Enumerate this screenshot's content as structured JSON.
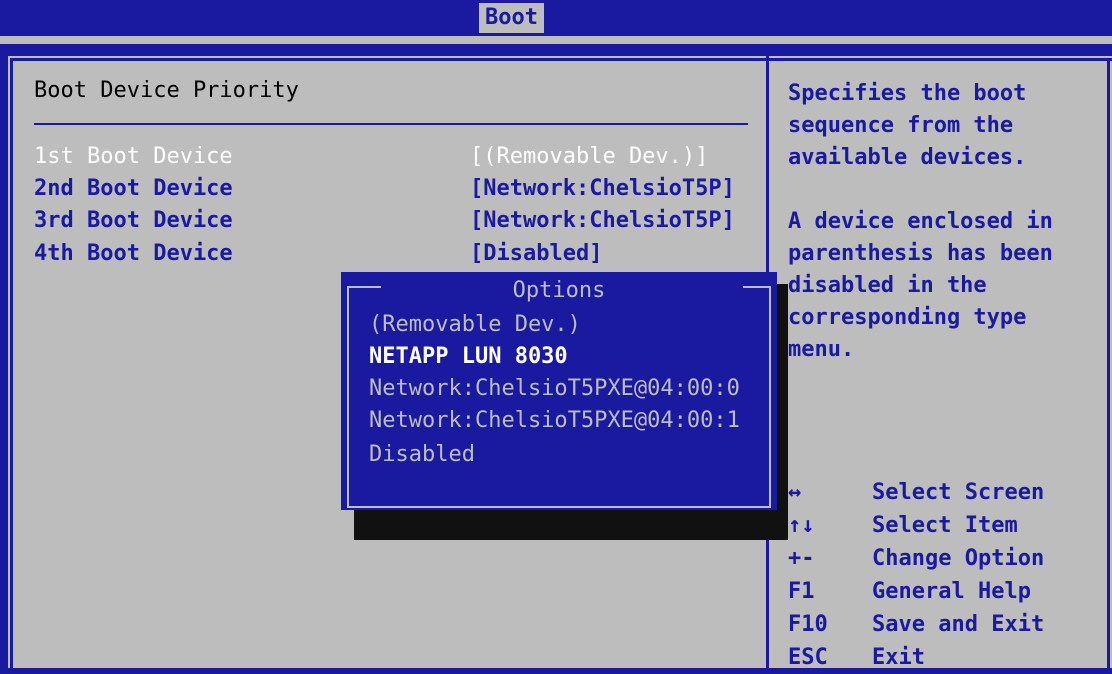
{
  "header": {
    "title": "Boot"
  },
  "main": {
    "section_title": "Boot Device Priority",
    "rows": [
      {
        "label": "1st Boot Device",
        "value": "[(Removable Dev.)]"
      },
      {
        "label": "2nd Boot Device",
        "value": "[Network:ChelsioT5P]"
      },
      {
        "label": "3rd Boot Device",
        "value": "[Network:ChelsioT5P]"
      },
      {
        "label": "4th Boot Device",
        "value": "[Disabled]"
      }
    ]
  },
  "help": {
    "para1": "Specifies the boot sequence from the available devices.",
    "para2": "A device enclosed in parenthesis has been disabled in the corresponding type menu."
  },
  "keys": [
    {
      "key": "↔",
      "action": "Select Screen"
    },
    {
      "key": "↑↓",
      "action": "Select Item"
    },
    {
      "key": "+-",
      "action": "Change Option"
    },
    {
      "key": "F1",
      "action": "General Help"
    },
    {
      "key": "F10",
      "action": "Save and Exit"
    },
    {
      "key": "ESC",
      "action": "Exit"
    }
  ],
  "popup": {
    "title": "Options",
    "options": [
      "(Removable Dev.)",
      "NETAPP LUN 8030",
      "Network:ChelsioT5PXE@04:00:0",
      "Network:ChelsioT5PXE@04:00:1",
      "Disabled"
    ],
    "highlighted_index": 1
  },
  "colors": {
    "bios_blue": "#1a1aa0",
    "bios_gray": "#bdbdbd"
  }
}
